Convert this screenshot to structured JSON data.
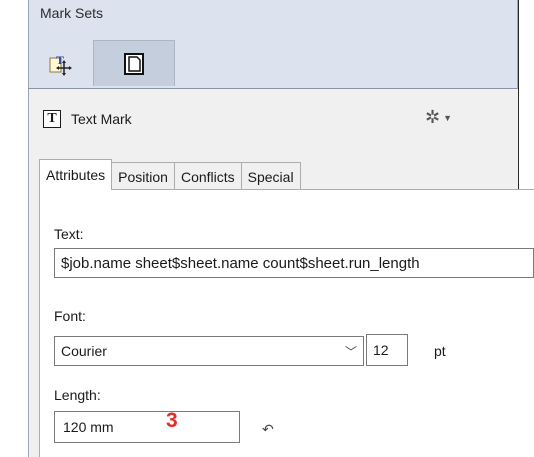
{
  "mark_sets": {
    "title": "Mark Sets",
    "buttons": [
      {
        "icon": "text-mark-tool-icon"
      },
      {
        "icon": "page-icon"
      }
    ]
  },
  "text_mark": {
    "icon_letter": "T",
    "title": "Text Mark",
    "menu_icon": "gear-icon"
  },
  "tabs": [
    {
      "label": "Attributes",
      "active": true
    },
    {
      "label": "Position",
      "active": false
    },
    {
      "label": "Conflicts",
      "active": false
    },
    {
      "label": "Special",
      "active": false
    }
  ],
  "fields": {
    "text_label": "Text:",
    "text_value": "$job.name sheet$sheet.name count$sheet.run_length",
    "font_label": "Font:",
    "font_value": "Courier",
    "font_size": "12",
    "font_unit": "pt",
    "length_label": "Length:",
    "length_value": "120 mm",
    "annotation": "3"
  }
}
